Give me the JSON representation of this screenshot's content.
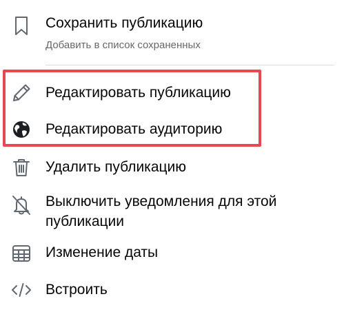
{
  "menu": {
    "items": [
      {
        "label": "Сохранить публикацию",
        "sublabel": "Добавить в список сохраненных",
        "icon": "bookmark-icon"
      },
      {
        "label": "Редактировать публикацию",
        "icon": "pencil-icon"
      },
      {
        "label": "Редактировать аудиторию",
        "icon": "globe-icon"
      },
      {
        "label": "Удалить публикацию",
        "icon": "trash-icon"
      },
      {
        "label": "Выключить уведомления для этой",
        "label_line2": "публикации",
        "icon": "bell-off-icon"
      },
      {
        "label": "Изменение даты",
        "icon": "calendar-icon"
      },
      {
        "label": "Встроить",
        "icon": "code-icon"
      }
    ]
  },
  "colors": {
    "highlight_border": "#e8474f",
    "text": "#050505",
    "secondary_text": "#65676b",
    "icon": "#606770",
    "divider": "#dadde1"
  }
}
